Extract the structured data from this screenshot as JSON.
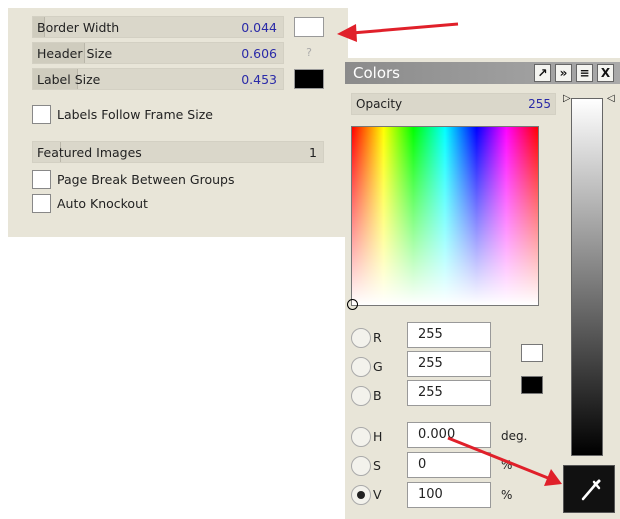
{
  "left_panel": {
    "rows": [
      {
        "label": "Border Width",
        "value": "0.044",
        "fill_fraction": 0.044
      },
      {
        "label": "Header Size",
        "value": "0.606",
        "fill_fraction": 0.606
      },
      {
        "label": "Label Size",
        "value": "0.453",
        "fill_fraction": 0.453
      }
    ],
    "header_size_button": "?",
    "checkboxes": {
      "labels_follow": "Labels Follow Frame Size",
      "page_break": "Page Break Between Groups",
      "auto_knockout": "Auto Knockout"
    },
    "featured": {
      "label": "Featured Images",
      "value": "1"
    },
    "swatch_colors": {
      "border": "#ffffff",
      "label": "#000000"
    }
  },
  "colors_panel": {
    "title": "Colors",
    "header_buttons": [
      "↗",
      "»",
      "≡",
      "X"
    ],
    "opacity": {
      "label": "Opacity",
      "value": "255"
    },
    "channels": [
      {
        "key": "R",
        "value": "255",
        "unit": ""
      },
      {
        "key": "G",
        "value": "255",
        "unit": ""
      },
      {
        "key": "B",
        "value": "255",
        "unit": ""
      },
      {
        "key": "H",
        "value": "0.000",
        "unit": "deg."
      },
      {
        "key": "S",
        "value": "0",
        "unit": "%"
      },
      {
        "key": "V",
        "value": "100",
        "unit": "%"
      }
    ],
    "selected_channel": "V",
    "fg_swatch": "#ffffff",
    "bg_swatch": "#000000"
  },
  "annotation_color": "#e0202a"
}
